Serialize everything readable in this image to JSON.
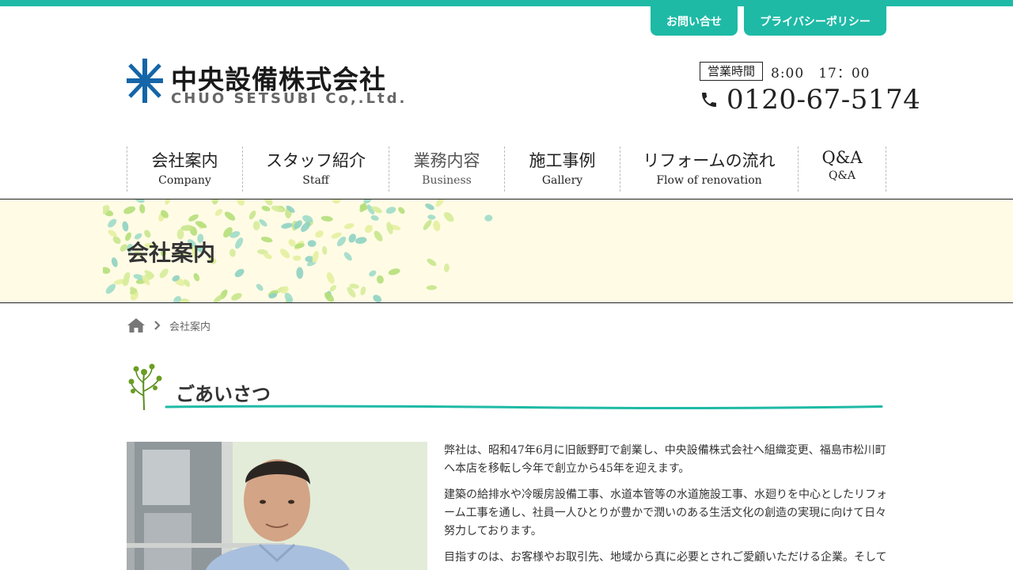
{
  "header": {
    "contact_label": "お問い合せ",
    "privacy_label": "プライバシーポリシー",
    "logo_name": "中央設備株式会社",
    "logo_sub": "CHUO SETSUBI Co,.Ltd.",
    "hours_label": "営業時間",
    "hours_value": "8:00　17：00",
    "phone_icon": "phone-icon",
    "phone_number": "0120-67-5174"
  },
  "nav": {
    "items": [
      {
        "jp": "会社案内",
        "en": "Company"
      },
      {
        "jp": "スタッフ紹介",
        "en": "Staff"
      },
      {
        "jp": "業務内容",
        "en": "Business"
      },
      {
        "jp": "施工事例",
        "en": "Gallery"
      },
      {
        "jp": "リフォームの流れ",
        "en": "Flow of renovation"
      },
      {
        "jp": "Q&A",
        "en": "Q&A"
      }
    ]
  },
  "hero": {
    "title": "会社案内"
  },
  "breadcrumb": {
    "home_icon": "home-icon",
    "current": "会社案内"
  },
  "section": {
    "title": "ごあいさつ",
    "icon": "sprout-icon"
  },
  "intro": {
    "paragraphs": [
      "弊社は、昭和47年6月に旧飯野町で創業し、中央設備株式会社へ組織変更、福島市松川町へ本店を移転し今年で創立から45年を迎えます。",
      "建築の給排水や冷暖房設備工事、水道本管等の水道施設工事、水廻りを中心としたリフォーム工事を通し、社員一人ひとりが豊かで潤いのある生活文化の創造の実現に向けて日々努力しております。",
      "目指すのは、お客様やお取引先、地域から真に必要とされご愛顧いただける企業。そして"
    ]
  },
  "colors": {
    "accent": "#1ebaa6",
    "hero_bg": "#fffbe5",
    "logo_blue": "#1565a8"
  }
}
